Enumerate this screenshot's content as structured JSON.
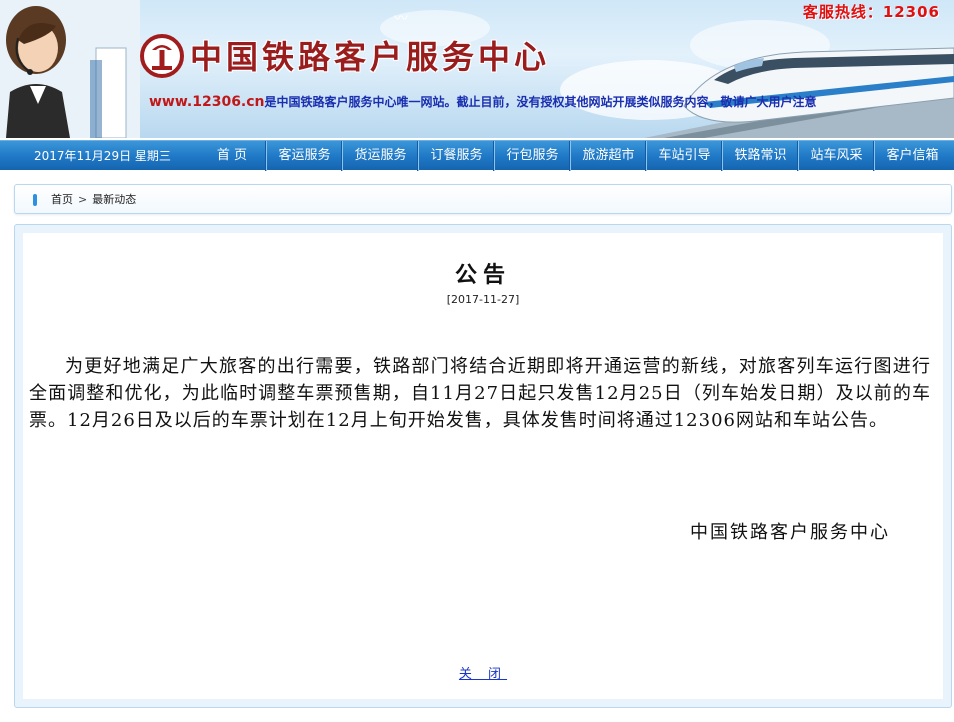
{
  "header": {
    "hotline": "客服热线：12306",
    "site_title": "中国铁路客户服务中心",
    "notice_url": "www.12306.cn",
    "notice_text": "是中国铁路客户服务中心唯一网站。截止目前，没有授权其他网站开展类似服务内容，敬请广大用户注意"
  },
  "navbar": {
    "date": "2017年11月29日 星期三",
    "items": [
      {
        "label": "首  页"
      },
      {
        "label": "客运服务"
      },
      {
        "label": "货运服务"
      },
      {
        "label": "订餐服务"
      },
      {
        "label": "行包服务"
      },
      {
        "label": "旅游超市"
      },
      {
        "label": "车站引导"
      },
      {
        "label": "铁路常识"
      },
      {
        "label": "站车风采"
      },
      {
        "label": "客户信箱"
      }
    ]
  },
  "breadcrumb": {
    "home": "首页",
    "separator": ">",
    "current": "最新动态"
  },
  "announcement": {
    "title": "公告",
    "date": "[2017-11-27]",
    "body": "为更好地满足广大旅客的出行需要，铁路部门将结合近期即将开通运营的新线，对旅客列车运行图进行全面调整和优化，为此临时调整车票预售期，自11月27日起只发售12月25日（列车始发日期）及以前的车票。12月26日及以后的车票计划在12月上旬开始发售，具体发售时间将通过12306网站和车站公告。",
    "signature": "中国铁路客户服务中心",
    "close_label": "关 闭"
  },
  "colors": {
    "nav_blue": "#1f78c6",
    "title_red": "#9a1d1d",
    "hotline_red": "#e01010",
    "notice_blue": "#1a2fb0",
    "link_blue": "#1a35c8"
  }
}
